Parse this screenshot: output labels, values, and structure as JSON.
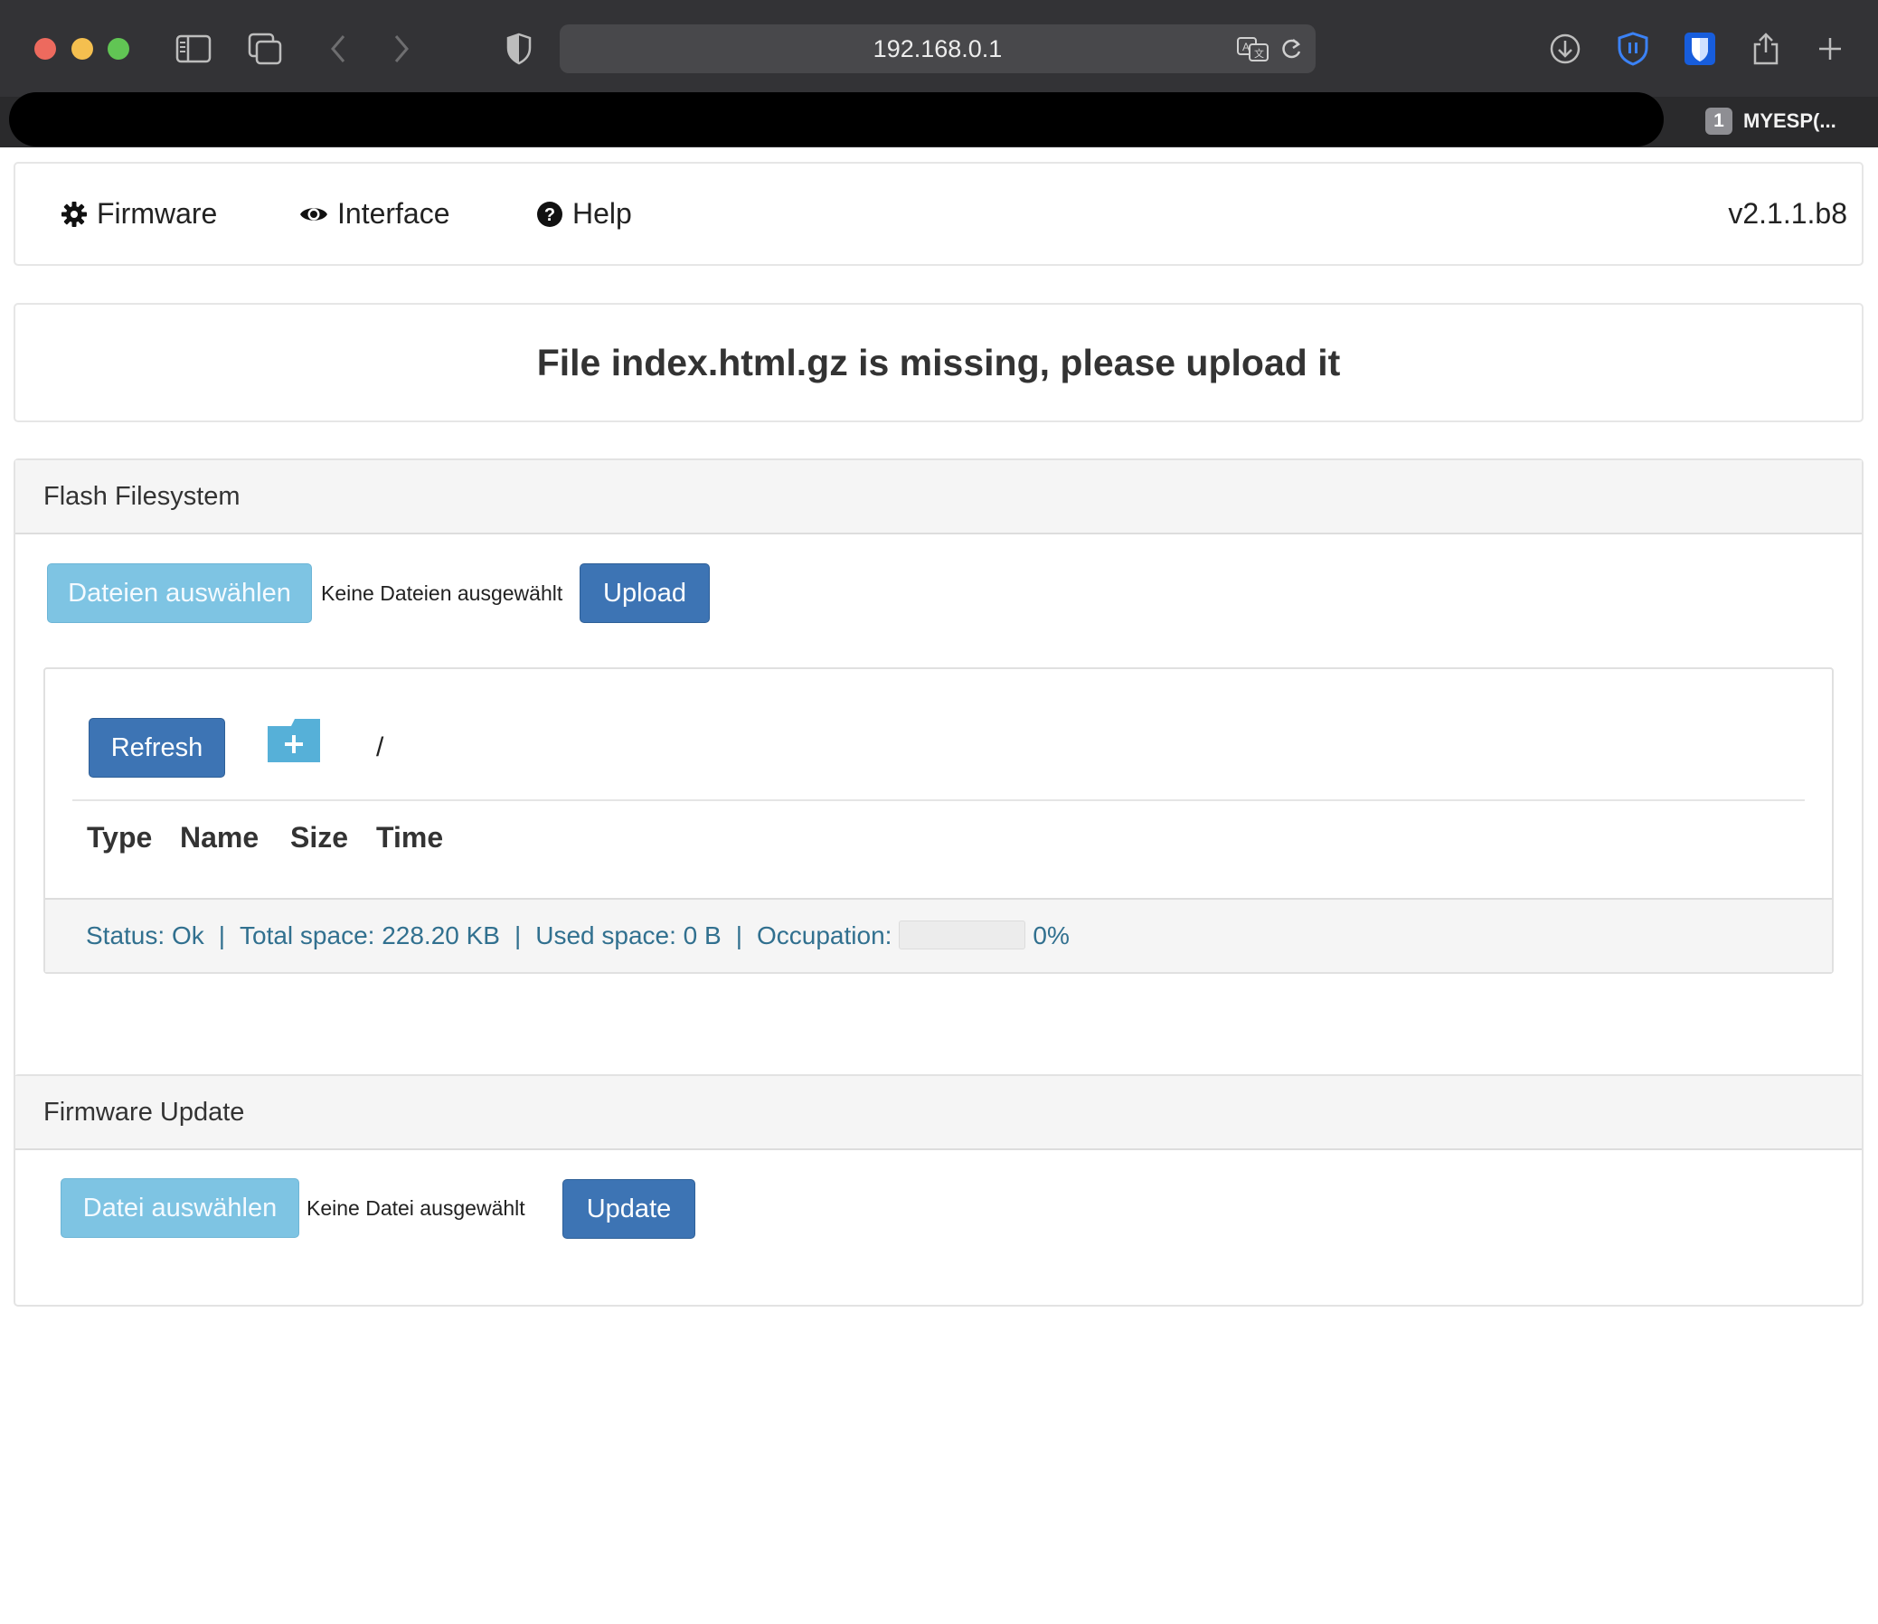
{
  "browser": {
    "url": "192.168.0.1",
    "tab_count": "1",
    "tab_title": "MYESP(..."
  },
  "nav": {
    "items": [
      {
        "label": "Firmware",
        "icon": "gear-icon"
      },
      {
        "label": "Interface",
        "icon": "eye-icon"
      },
      {
        "label": "Help",
        "icon": "question-circle-icon"
      }
    ],
    "version": "v2.1.1.b8"
  },
  "alert": {
    "message": "File index.html.gz is missing, please upload it"
  },
  "flash_fs": {
    "title": "Flash Filesystem",
    "choose_files_label": "Dateien auswählen",
    "no_files_text": "Keine Dateien ausgewählt",
    "upload_label": "Upload",
    "refresh_label": "Refresh",
    "current_path": "/",
    "columns": [
      "Type",
      "Name",
      "Size",
      "Time"
    ],
    "status": {
      "status_text": "Status: Ok",
      "total_space": "Total space: 228.20 KB",
      "used_space": "Used space: 0 B",
      "occupation_label": "Occupation:",
      "occupation_value": "0%",
      "occupation_fraction": 0
    }
  },
  "firmware_update": {
    "title": "Firmware Update",
    "choose_file_label": "Datei auswählen",
    "no_file_text": "Keine Datei ausgewählt",
    "update_label": "Update"
  },
  "colors": {
    "primary_button": "#3d74b4",
    "light_button": "#7ec4e3",
    "status_text": "#31708f"
  }
}
